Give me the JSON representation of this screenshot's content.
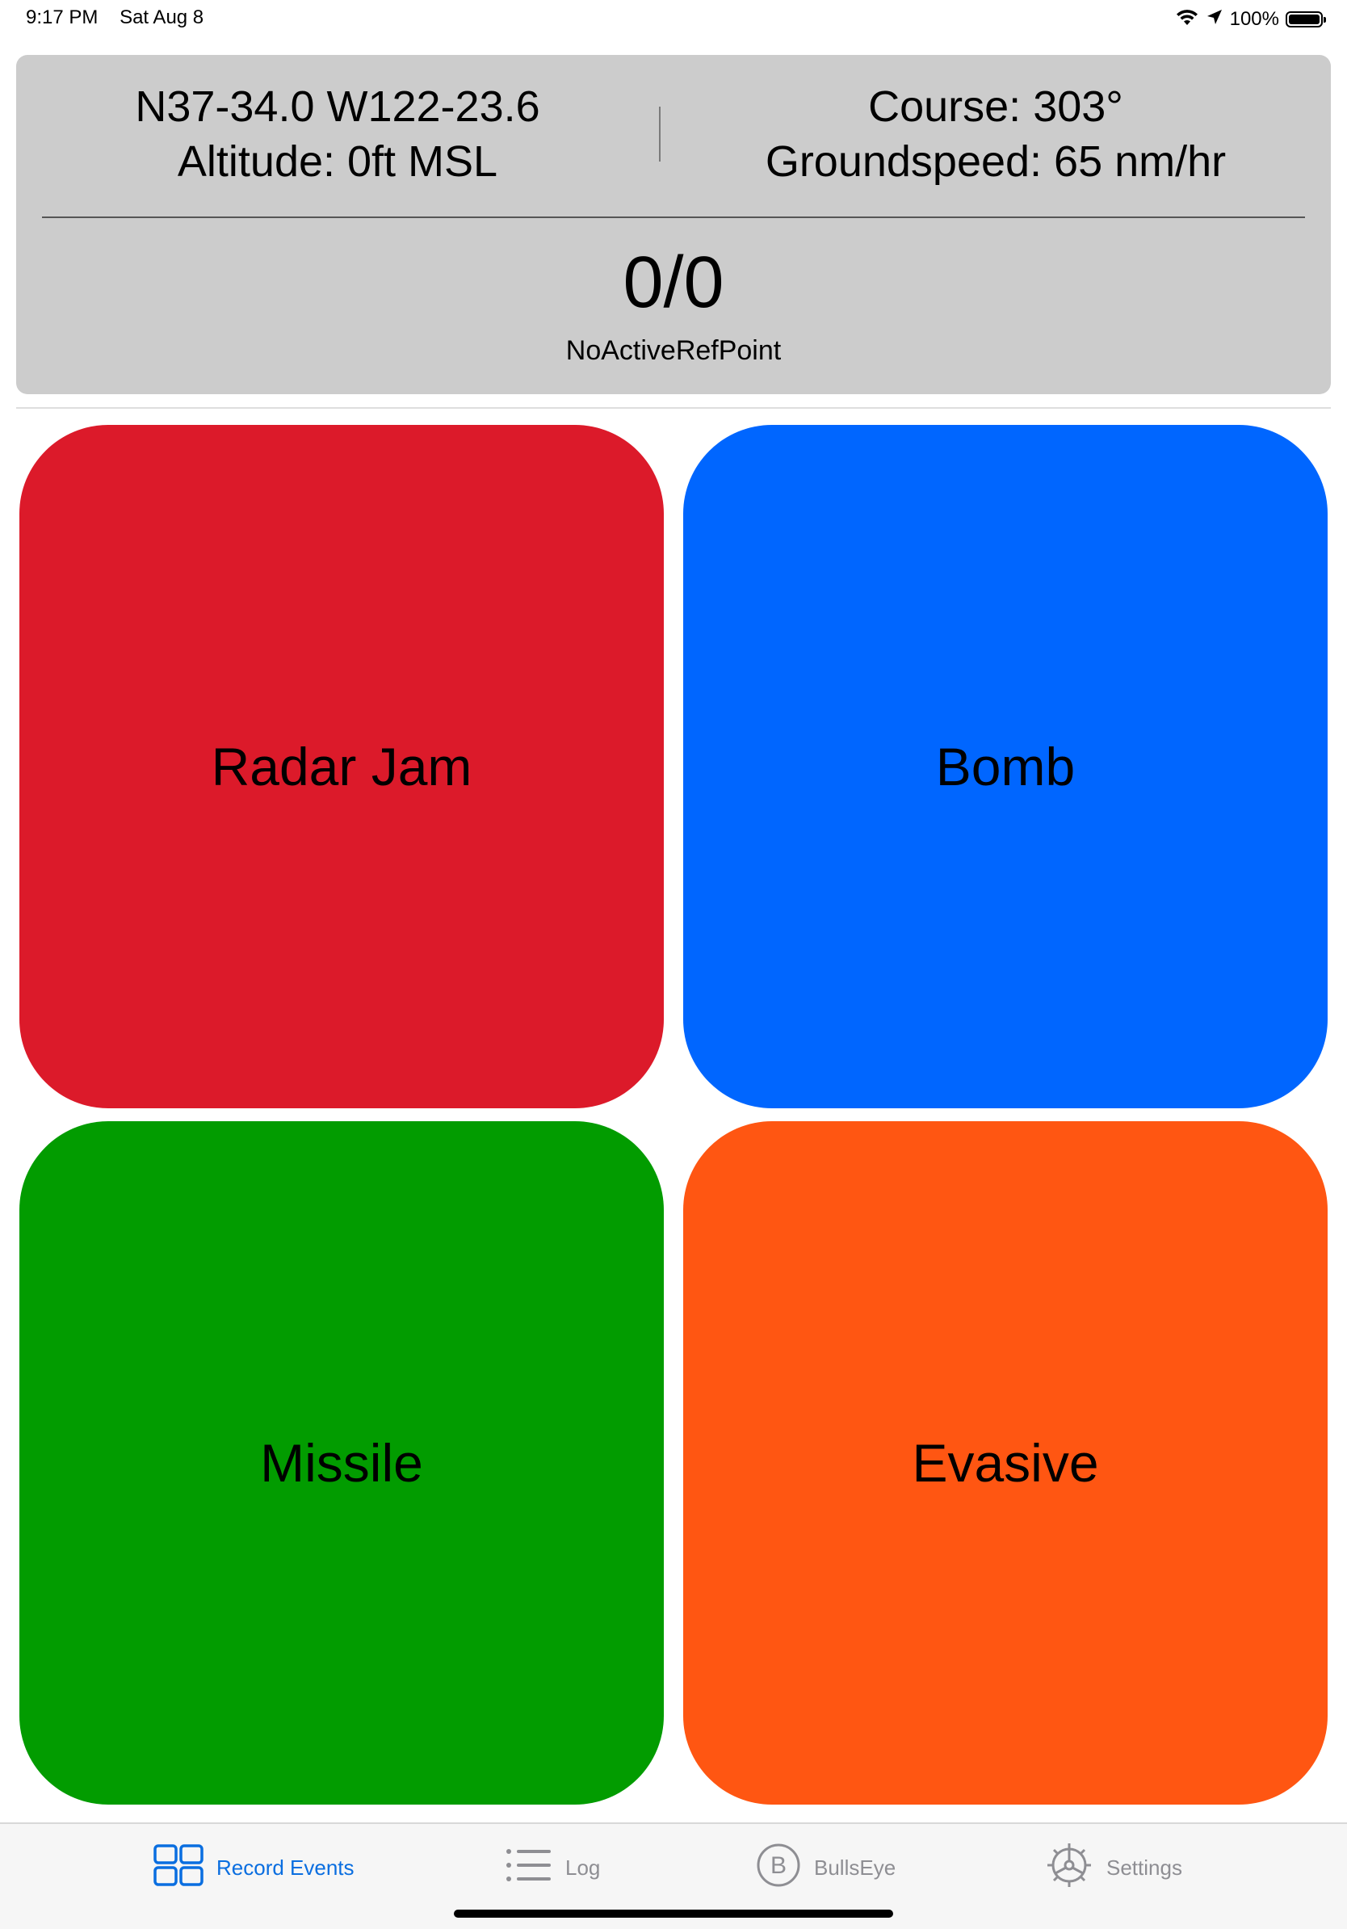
{
  "status_bar": {
    "time": "9:17 PM",
    "date": "Sat Aug 8",
    "battery_text": "100%",
    "battery_level": 1.0,
    "icons": [
      "wifi-icon",
      "location-arrow-icon",
      "battery-icon"
    ]
  },
  "info": {
    "position": "N37-34.0 W122-23.6",
    "altitude": "Altitude: 0ft MSL",
    "course": "Course: 303°",
    "groundspeed": "Groundspeed: 65 nm/hr",
    "ref_value": "0/0",
    "ref_label": "NoActiveRefPoint"
  },
  "buttons": [
    {
      "label": "Radar Jam",
      "color": "#dc1a2a"
    },
    {
      "label": "Bomb",
      "color": "#0066ff"
    },
    {
      "label": "Missile",
      "color": "#029c00"
    },
    {
      "label": "Evasive",
      "color": "#ff5612"
    }
  ],
  "tabs": [
    {
      "label": "Record Events",
      "icon": "grid-icon",
      "active": true
    },
    {
      "label": "Log",
      "icon": "list-icon",
      "active": false
    },
    {
      "label": "BullsEye",
      "icon": "bullseye-b-icon",
      "active": false
    },
    {
      "label": "Settings",
      "icon": "gear-icon",
      "active": false
    }
  ],
  "colors": {
    "accent": "#0a6ee0",
    "inactive_tab": "#8e8e93",
    "panel_bg": "#cccccc"
  }
}
